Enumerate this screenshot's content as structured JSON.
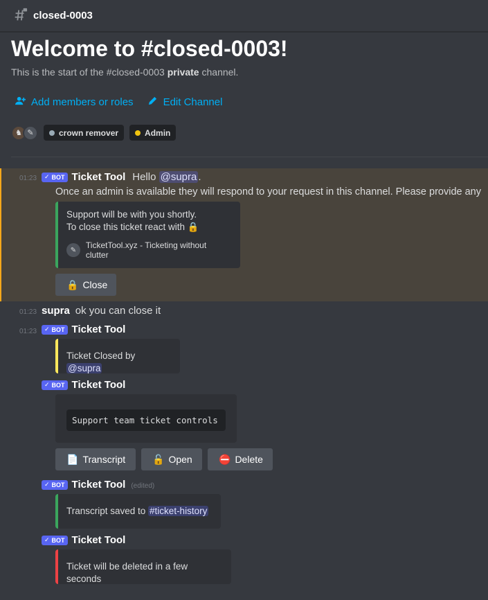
{
  "header": {
    "channel_name": "closed-0003"
  },
  "welcome": {
    "title": "Welcome to #closed-0003!",
    "sub_prefix": "This is the start of the #closed-0003 ",
    "sub_bold": "private",
    "sub_suffix": " channel."
  },
  "actions": {
    "add_members": "Add members or roles",
    "edit_channel": "Edit Channel"
  },
  "roles": [
    {
      "label": "crown remover",
      "color": "#99aab5"
    },
    {
      "label": "Admin",
      "color": "#f1c40f"
    }
  ],
  "messages": {
    "m1": {
      "time": "01:23",
      "bot_tag": "BOT",
      "author": "Ticket Tool",
      "text_prefix": "Hello ",
      "mention": "@supra",
      "text_suffix": ".",
      "line2": "Once an admin is available they will respond to your request in this channel. Please provide any",
      "embed_line1": "Support will be with you shortly.",
      "embed_line2": "To close this ticket react with",
      "embed_footer": "TicketTool.xyz - Ticketing without clutter",
      "button": "Close"
    },
    "m2": {
      "time": "01:23",
      "author": "supra",
      "text": "ok you can close it"
    },
    "m3": {
      "time": "01:23",
      "bot_tag": "BOT",
      "author": "Ticket Tool",
      "embed_prefix": "Ticket Closed by ",
      "embed_mention": "@supra"
    },
    "m4": {
      "bot_tag": "BOT",
      "author": "Ticket Tool",
      "code": "Support team ticket controls",
      "buttons": {
        "transcript": "Transcript",
        "open": "Open",
        "delete": "Delete"
      }
    },
    "m5": {
      "bot_tag": "BOT",
      "author": "Ticket Tool",
      "edited": "(edited)",
      "embed_prefix": "Transcript saved to ",
      "embed_channel": "#ticket-history"
    },
    "m6": {
      "bot_tag": "BOT",
      "author": "Ticket Tool",
      "embed_text": "Ticket will be deleted in a few seconds"
    }
  },
  "colors": {
    "background": "#36393f",
    "link": "#00aff4",
    "bot_tag": "#5865f2",
    "highlight": "#49443c",
    "embed_green": "#3ba55d",
    "embed_yellow": "#fee75c",
    "embed_red": "#ed4245"
  }
}
